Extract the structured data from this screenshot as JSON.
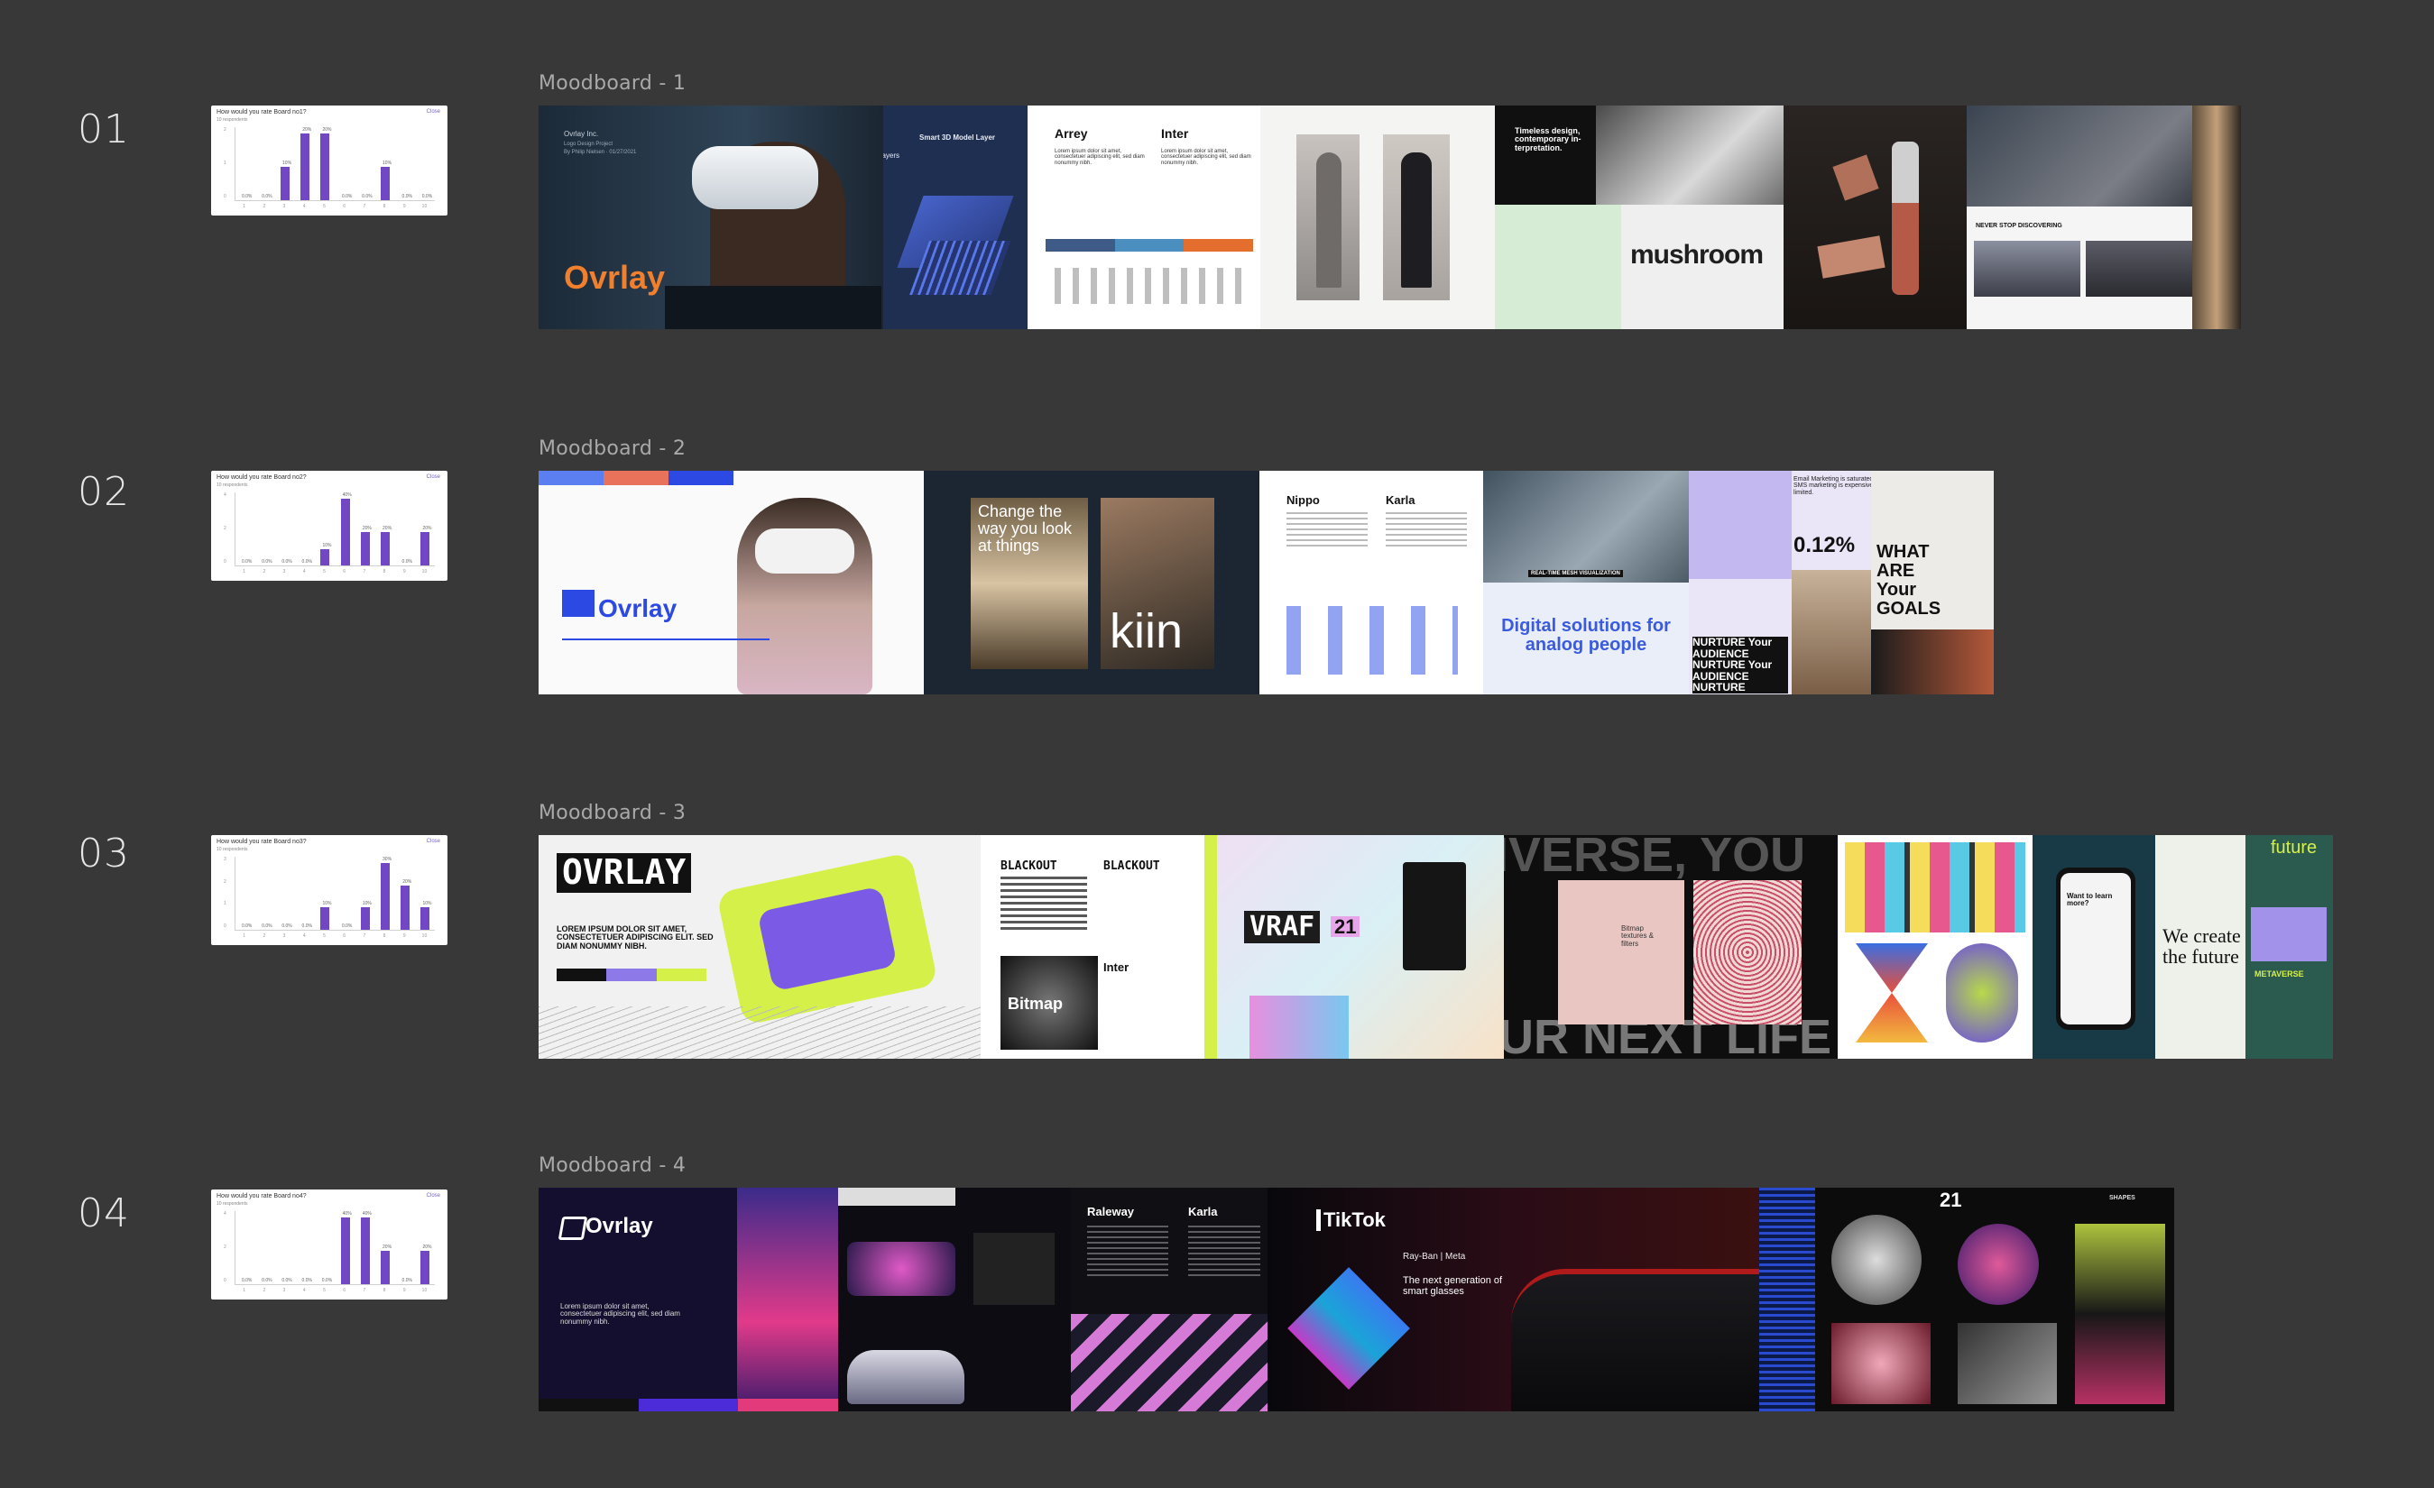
{
  "rows": [
    {
      "number": "01",
      "title": "Moodboard - 1",
      "thumbnail": {
        "question": "How would you rate Board no1?",
        "subtitle": "10 respondents",
        "close_label": "Close",
        "y_ticks": [
          "2",
          "1",
          "0"
        ],
        "x_ticks": [
          "1",
          "2",
          "3",
          "4",
          "5",
          "6",
          "7",
          "8",
          "9",
          "10"
        ],
        "values": [
          0,
          0,
          10,
          20,
          20,
          0,
          0,
          10,
          0,
          0
        ],
        "labels": [
          "0.0%",
          "0.0%",
          "10%",
          "20%",
          "20%",
          "0.0%",
          "0.0%",
          "10%",
          "0.0%",
          "0.0%"
        ]
      },
      "tiles": {
        "ovrlay_word": "Ovrlay",
        "header_small": "Ovrlay Inc.",
        "header_line2": "Logo Design Project",
        "header_line3": "By Philip Nielsen · 01/27/2021",
        "smart_layer": "Smart 3D Model Layer",
        "layers": "Layers",
        "font_a": "Arrey",
        "font_b": "Inter",
        "lorem_a": "Lorem ipsum dolor sit amet, consectetuer adipiscing elit, sed diam nonummy nibh.",
        "timeless": "Timeless design, contemporary in- terpretation.",
        "mushroom": "mushroom",
        "never_stop": "NEVER STOP DISCOVERING"
      }
    },
    {
      "number": "02",
      "title": "Moodboard - 2",
      "thumbnail": {
        "question": "How would you rate Board no2?",
        "subtitle": "10 respondents",
        "close_label": "Close",
        "y_ticks": [
          "4",
          "2",
          "0"
        ],
        "x_ticks": [
          "1",
          "2",
          "3",
          "4",
          "5",
          "6",
          "7",
          "8",
          "9",
          "10"
        ],
        "values": [
          0,
          0,
          0,
          0,
          10,
          40,
          20,
          20,
          0,
          20
        ],
        "labels": [
          "0.0%",
          "0.0%",
          "0.0%",
          "0.0%",
          "10%",
          "40%",
          "20%",
          "20%",
          "0.0%",
          "20%"
        ]
      },
      "tiles": {
        "ovrlay_word": "Ovrlay",
        "change": "Change the way you look at things",
        "kiin": "kiin",
        "font_a": "Nippo",
        "font_b": "Karla",
        "realtime": "REAL-TIME MESH VISUALIZATION",
        "digital": "Digital solutions for analog people",
        "email": "Email Marketing is saturated and SMS marketing is expensive & limited.",
        "percent": "0.12%",
        "what": "WHAT ARE Your GOALS",
        "nurture": "NURTURE Your AUDIENCE NURTURE Your AUDIENCE NURTURE"
      }
    },
    {
      "number": "03",
      "title": "Moodboard - 3",
      "thumbnail": {
        "question": "How would you rate Board no3?",
        "subtitle": "10 respondents",
        "close_label": "Close",
        "y_ticks": [
          "3",
          "2",
          "1",
          "0"
        ],
        "x_ticks": [
          "1",
          "2",
          "3",
          "4",
          "5",
          "6",
          "7",
          "8",
          "9",
          "10"
        ],
        "values": [
          0,
          0,
          0,
          0,
          10,
          0,
          10,
          30,
          20,
          10
        ],
        "labels": [
          "0.0%",
          "0.0%",
          "0.0%",
          "0.0%",
          "10%",
          "0.0%",
          "10%",
          "30%",
          "20%",
          "10%"
        ]
      },
      "tiles": {
        "ovrlay_word": "OVRLAY",
        "lorem_caps": "LOREM IPSUM DOLOR SIT AMET, CONSECTETUER ADIPISCING ELIT. SED DIAM NONUMMY NIBH.",
        "blackout": "BLACKOUT",
        "inter": "Inter",
        "bitmap": "Bitmap",
        "vraf": "VRAF",
        "vraf_num": "21",
        "universe": "IVERSE, YOU",
        "next_life": "UR NEXT LIFE",
        "bitmap_textures": "Bitmap textures & filters",
        "we_create": "We create the future",
        "metaverse": "METAVERSE",
        "future": "future",
        "want": "Want to learn more?"
      }
    },
    {
      "number": "04",
      "title": "Moodboard - 4",
      "thumbnail": {
        "question": "How would you rate Board no4?",
        "subtitle": "10 respondents",
        "close_label": "Close",
        "y_ticks": [
          "4",
          "2",
          "0"
        ],
        "x_ticks": [
          "1",
          "2",
          "3",
          "4",
          "5",
          "6",
          "7",
          "8",
          "9",
          "10"
        ],
        "values": [
          0,
          0,
          0,
          0,
          0,
          40,
          40,
          20,
          0,
          20
        ],
        "labels": [
          "0.0%",
          "0.0%",
          "0.0%",
          "0.0%",
          "0.0%",
          "40%",
          "40%",
          "20%",
          "0.0%",
          "20%"
        ]
      },
      "tiles": {
        "ovrlay_word": "Ovrlay",
        "lorem": "Lorem ipsum dolor sit amet, consectetuer adipiscing elit, sed diam nonummy nibh.",
        "font_a": "Raleway",
        "font_b": "Karla",
        "tiktok": "TikTok",
        "rayban": "Ray-Ban | Meta",
        "next_gen": "The next generation of smart glasses",
        "num21": "21",
        "shapes": "SHAPES"
      }
    }
  ],
  "colors": {
    "background": "#383838",
    "bar": "#7247c4",
    "ovrlay_orange": "#f07f2e",
    "ovrlay_blue": "#2b4ee0",
    "lime": "#d6f04a"
  }
}
